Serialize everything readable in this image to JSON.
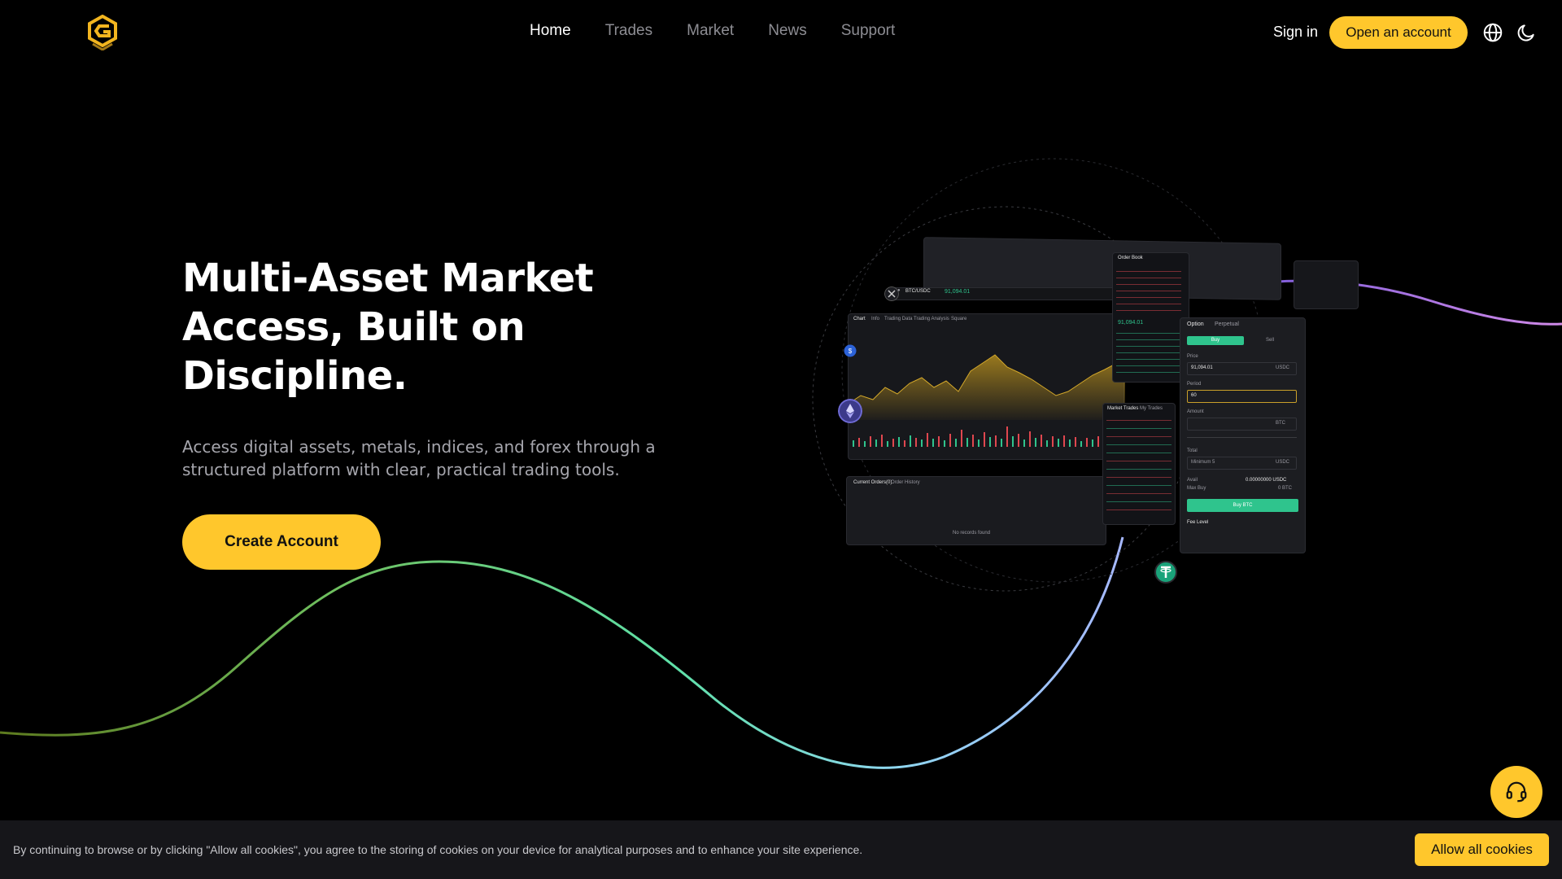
{
  "header": {
    "nav": [
      "Home",
      "Trades",
      "Market",
      "News",
      "Support"
    ],
    "active_nav": "Home",
    "sign_in": "Sign in",
    "open_account": "Open an account"
  },
  "hero": {
    "title": "Multi-Asset Market Access, Built on Discipline.",
    "subtitle": "Access digital assets, metals, indices, and forex through a structured platform with clear, practical trading tools.",
    "cta": "Create Account"
  },
  "mockup": {
    "pair": "BTC/USDC",
    "price": "91,094.01",
    "chart_tabs": [
      "Chart",
      "Info",
      "Trading Data",
      "Trading Analysis",
      "Square"
    ],
    "order_book_title": "Order Book",
    "mid_price": "91,094.01",
    "trade_tabs": [
      "Option",
      "Perpetual"
    ],
    "side_buy": "Buy",
    "side_sell": "Sell",
    "price_label": "Price",
    "price_value": "91,094.01",
    "price_unit": "USDC",
    "period_label": "Period",
    "period_value": "60",
    "amount_label": "Amount",
    "amount_unit": "BTC",
    "total_label": "Total",
    "total_placeholder": "Minimum 5",
    "total_unit": "USDC",
    "avail_label": "Avail",
    "avail_value": "0.00000000 USDC",
    "max_buy_label": "Max Buy",
    "max_buy_value": "0 BTC",
    "buy_button": "Buy BTC",
    "fee_label": "Fee Level",
    "market_trades_tabs": [
      "Market Trades",
      "My Trades"
    ],
    "orders_tabs": [
      "Current Orders(0)",
      "Order History"
    ],
    "no_orders": "No records found"
  },
  "cookie": {
    "text": "By continuing to browse or by clicking \"Allow all cookies\", you agree to the storing of cookies on your device for analytical purposes and to enhance your site experience.",
    "button": "Allow all cookies"
  },
  "colors": {
    "accent": "#ffc72c",
    "background": "#000000",
    "buy_green": "#2fc48d",
    "sell_red": "#e0474f"
  },
  "icons": [
    "logo-icon",
    "globe-icon",
    "moon-icon",
    "headset-icon"
  ]
}
